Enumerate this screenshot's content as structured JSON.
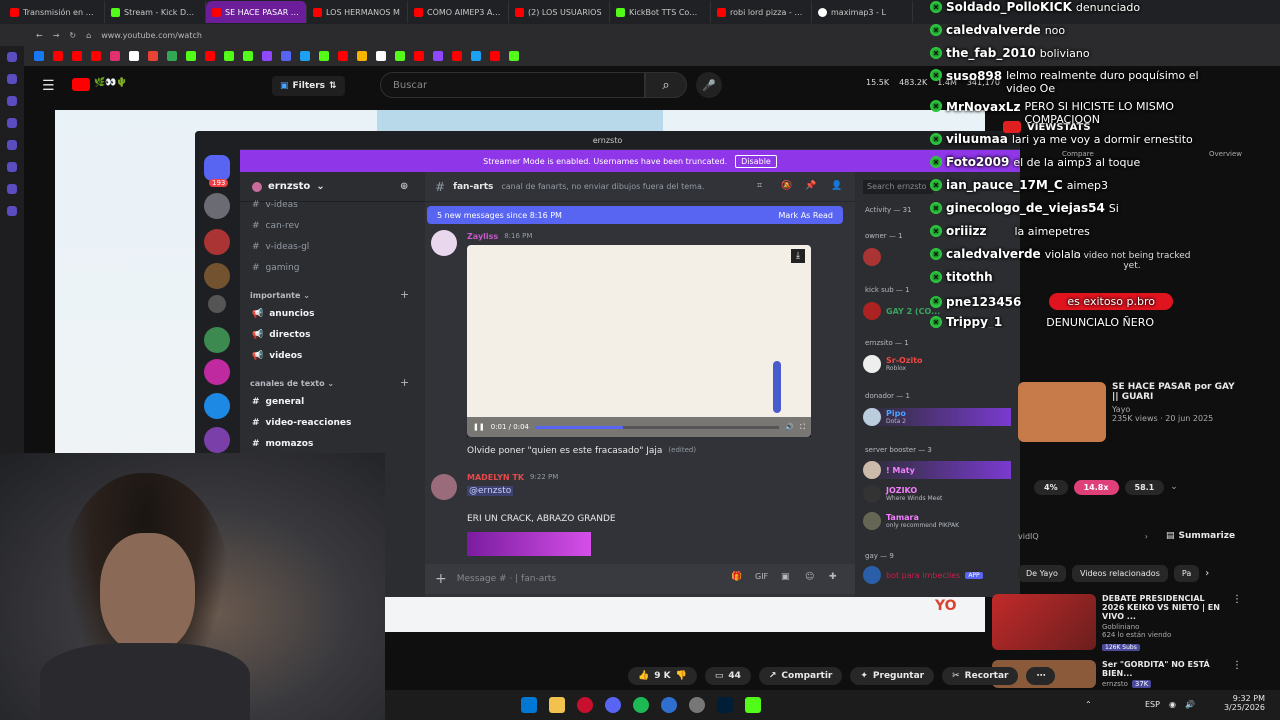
{
  "browser": {
    "tabs": [
      {
        "label": "Transmisión en vivo",
        "color": "#ff0000",
        "active": false
      },
      {
        "label": "Stream - Kick Dashb",
        "color": "#53fc18",
        "active": false
      },
      {
        "label": "SE HACE PASAR por GAY",
        "color": "#ff0000",
        "active": true
      },
      {
        "label": "LOS HERMANOS M",
        "color": "#ff0000",
        "active": false
      },
      {
        "label": "CÓMO AIMEP3 ARR",
        "color": "#ff0000",
        "active": false
      },
      {
        "label": "(2) LOS USUARIOS",
        "color": "#ff0000",
        "active": false
      },
      {
        "label": "KickBot TTS Comma",
        "color": "#53fc18",
        "active": false
      },
      {
        "label": "robi lord pizza - You",
        "color": "#ff0000",
        "active": false
      },
      {
        "label": "maximap3 - L",
        "color": "#ffffff",
        "active": false
      }
    ],
    "url": "www.youtube.com/watch",
    "ext_label": "ext",
    "ai_label": "AI"
  },
  "youtube": {
    "filters_label": "Filters",
    "search_placeholder": "Buscar",
    "header_stats": [
      "15.5K",
      "483.2K",
      "1.4M",
      "341,170"
    ],
    "stats_pills": [
      "4%",
      "14.8x",
      "58.1"
    ],
    "vidiq_label": "vidIQ",
    "summarize_label": "Summarize",
    "chips": [
      "De Yayo",
      "Videos relacionados",
      "Pa"
    ],
    "recommended": [
      {
        "title": "SE HACE PASAR por GAY || GUARI",
        "channel": "Yayo",
        "meta": "235K views · 20 jun 2025",
        "thumb_color": "#c77a4a"
      },
      {
        "title": "DEBATE PRESIDENCIAL 2026 KEIKO VS NIETO | EN VIVO ...",
        "channel": "Gobliniano",
        "meta": "624 lo están viendo",
        "badge": "126K Subs",
        "thumb_color": "#c22a2a"
      },
      {
        "title": "Ser \"GORDITA\" NO ESTÁ BIEN...",
        "channel": "ernzsto",
        "meta": "",
        "badge": "37K",
        "thumb_color": "#8a5a3a"
      }
    ],
    "actions": {
      "likes": "9 K",
      "comments": "44",
      "share": "Compartir",
      "ask": "Preguntar",
      "clip": "Recortar"
    },
    "viewstats_label": "VIEWSTATS",
    "viewstats_tabs": [
      "Compare",
      "Overview"
    ],
    "tracking_text": "is video not being tracked yet.",
    "yo_label": "YO"
  },
  "discord": {
    "window_title": "ernzsto",
    "streamer_banner": "Streamer Mode is enabled. Usernames have been truncated.",
    "disable_label": "Disable",
    "server_name": "ernzsto",
    "server_badge": "193",
    "channels_top": [
      "v-ideas",
      "can-rev",
      "v-ideas-gl",
      "gaming"
    ],
    "category_importante": "importante",
    "channels_importante": [
      "anuncios",
      "directos",
      "videos"
    ],
    "category_texto": "canales de texto",
    "channels_texto": [
      "general",
      "video-reacciones",
      "momazos"
    ],
    "channel_name": "fan-arts",
    "channel_topic": "canal de fanarts, no enviar dibujos fuera del tema.",
    "new_messages": "5 new messages since 8:16 PM",
    "mark_as_read": "Mark As Read",
    "search_placeholder": "Search ernzsto",
    "messages": [
      {
        "author": "Zayliss",
        "time": "8:16 PM",
        "text": "Olvide poner \"quien es este fracasado\" Jaja",
        "edited": "(edited)"
      },
      {
        "author": "MADELYN TK",
        "time": "9:22 PM",
        "mention": "@ernzsto",
        "text": "ERI UN CRACK, ABRAZO GRANDE"
      }
    ],
    "video_time": "0:01 / 0:04",
    "composer_placeholder": "Message # · | fan-arts",
    "members": {
      "activity_header": "Activity — 31",
      "owner_header": "owner — 1",
      "kick_sub_header": "kick sub — 1",
      "kick_sub_member": "GAY 2 (CO...",
      "ernzsito_header": "ernzsito — 1",
      "ernzsito_member": "Sr-Ozito",
      "ernzsito_sub": "Roblox",
      "donador_header": "donador — 1",
      "donador_member": "Pipo",
      "donador_sub": "Dota 2",
      "booster_header": "server booster — 3",
      "boosters": [
        {
          "name": "! Maty",
          "sub": ""
        },
        {
          "name": "JOZIKO",
          "sub": "Where Winds Meet"
        },
        {
          "name": "Tamara",
          "sub": "only recommend PIKPAK"
        }
      ],
      "gay_header": "gay — 9",
      "gay_member": "bot para imbeciles",
      "app_badge": "APP"
    }
  },
  "kick_chat": [
    {
      "name": "Soldado_PolloKICK",
      "text": "denunciado"
    },
    {
      "name": "caledvalverde",
      "text": "noo"
    },
    {
      "name": "the_fab_2010",
      "text": "boliviano"
    },
    {
      "name": "suso898",
      "text": "lelmo realmente duro poquísimo el video Oe"
    },
    {
      "name": "MrNovaxLz",
      "text": "PERO SI HICISTE LO MISMO COMPACIOON"
    },
    {
      "name": "viluumaa",
      "text": "lari ya me voy a dormir ernestito"
    },
    {
      "name": "Foto2009",
      "text": "el de la aimp3 al toque"
    },
    {
      "name": "ian_pauce_17M_C",
      "text": "aimep3"
    },
    {
      "name": "ginecologo_de_viejas54",
      "text": "Si"
    },
    {
      "name": "oriiizz",
      "text": "la aimepetres"
    },
    {
      "name": "caledvalverde",
      "text": "violalo"
    },
    {
      "name": "titothh",
      "text": ""
    },
    {
      "name": "pne123456",
      "text": "es exitoso p.bro",
      "highlight": true
    },
    {
      "name": "Trippy_1",
      "text": "DENUNCIALO ÑERO"
    }
  ],
  "taskbar": {
    "time": "9:32 PM",
    "date": "3/25/2026",
    "lang": "ESP"
  }
}
